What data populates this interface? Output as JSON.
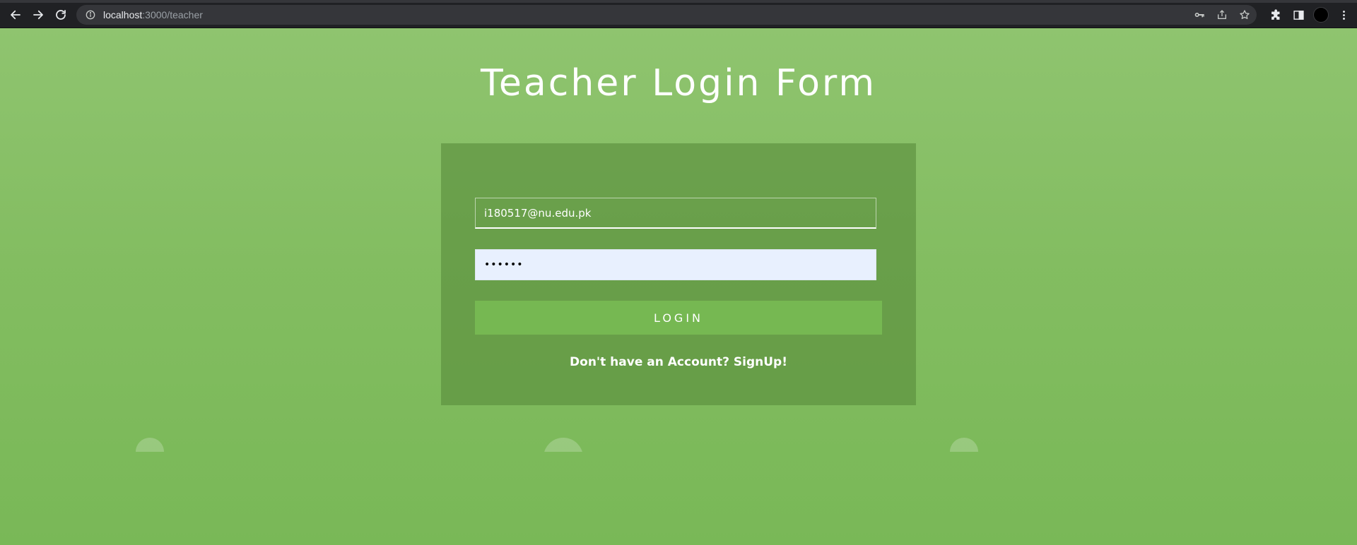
{
  "browser": {
    "url_host": "localhost",
    "url_path": ":3000/teacher",
    "icons": {
      "back": "arrow-left-icon",
      "forward": "arrow-right-icon",
      "reload": "reload-icon",
      "site_info": "info-icon",
      "password": "key-icon",
      "share": "share-icon",
      "bookmark": "star-icon",
      "extensions": "puzzle-icon",
      "side_panel": "side-panel-icon",
      "menu": "kebab-menu-icon"
    }
  },
  "page": {
    "title": "Teacher Login Form",
    "email_value": "i180517@nu.edu.pk",
    "password_value": "••••••",
    "login_label": "LOGIN",
    "signup_text": "Don't have an Account? SignUp!"
  },
  "colors": {
    "background_top": "#8fc46f",
    "background_bottom": "#79b857",
    "form_box": "#6b9e51",
    "button": "#76b852",
    "password_field": "#e8f0fe"
  }
}
